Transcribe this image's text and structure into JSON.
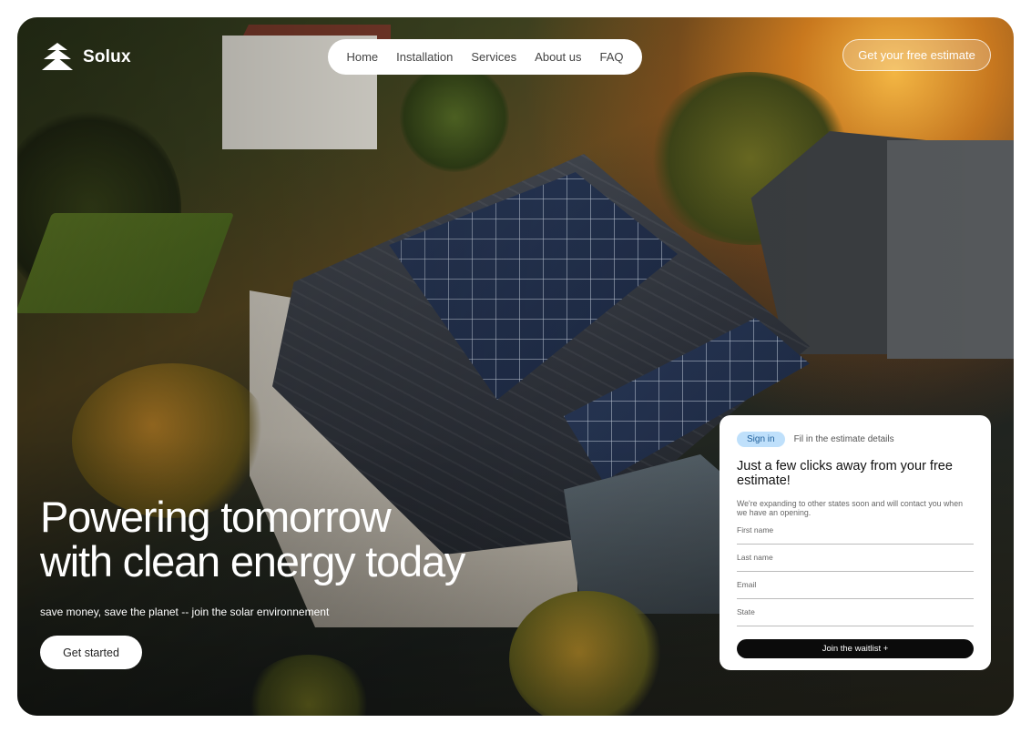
{
  "brand": {
    "name": "Solux",
    "logo_icon": "pine-tree-icon"
  },
  "nav": {
    "items": [
      "Home",
      "Installation",
      "Services",
      "About us",
      "FAQ"
    ]
  },
  "header": {
    "cta_label": "Get your free estimate"
  },
  "hero": {
    "title_line1": "Powering tomorrow",
    "title_line2": "with clean energy today",
    "subtitle": "save money, save the planet -- join the solar environnement",
    "button_label": "Get started"
  },
  "form": {
    "pill_label": "Sign in",
    "step_text": "Fil in the estimate details",
    "title": "Just a few clicks away from your free estimate!",
    "note": "We're expanding to other states soon and will contact you when we have an opening.",
    "fields": [
      {
        "placeholder": "First name"
      },
      {
        "placeholder": "Last name"
      },
      {
        "placeholder": "Email"
      },
      {
        "placeholder": "State"
      }
    ],
    "submit_label": "Join the waitlist +"
  },
  "colors": {
    "accent_pill": "#bfe0fb",
    "button_dark": "#0b0b0b",
    "sun": "#f5a623"
  }
}
